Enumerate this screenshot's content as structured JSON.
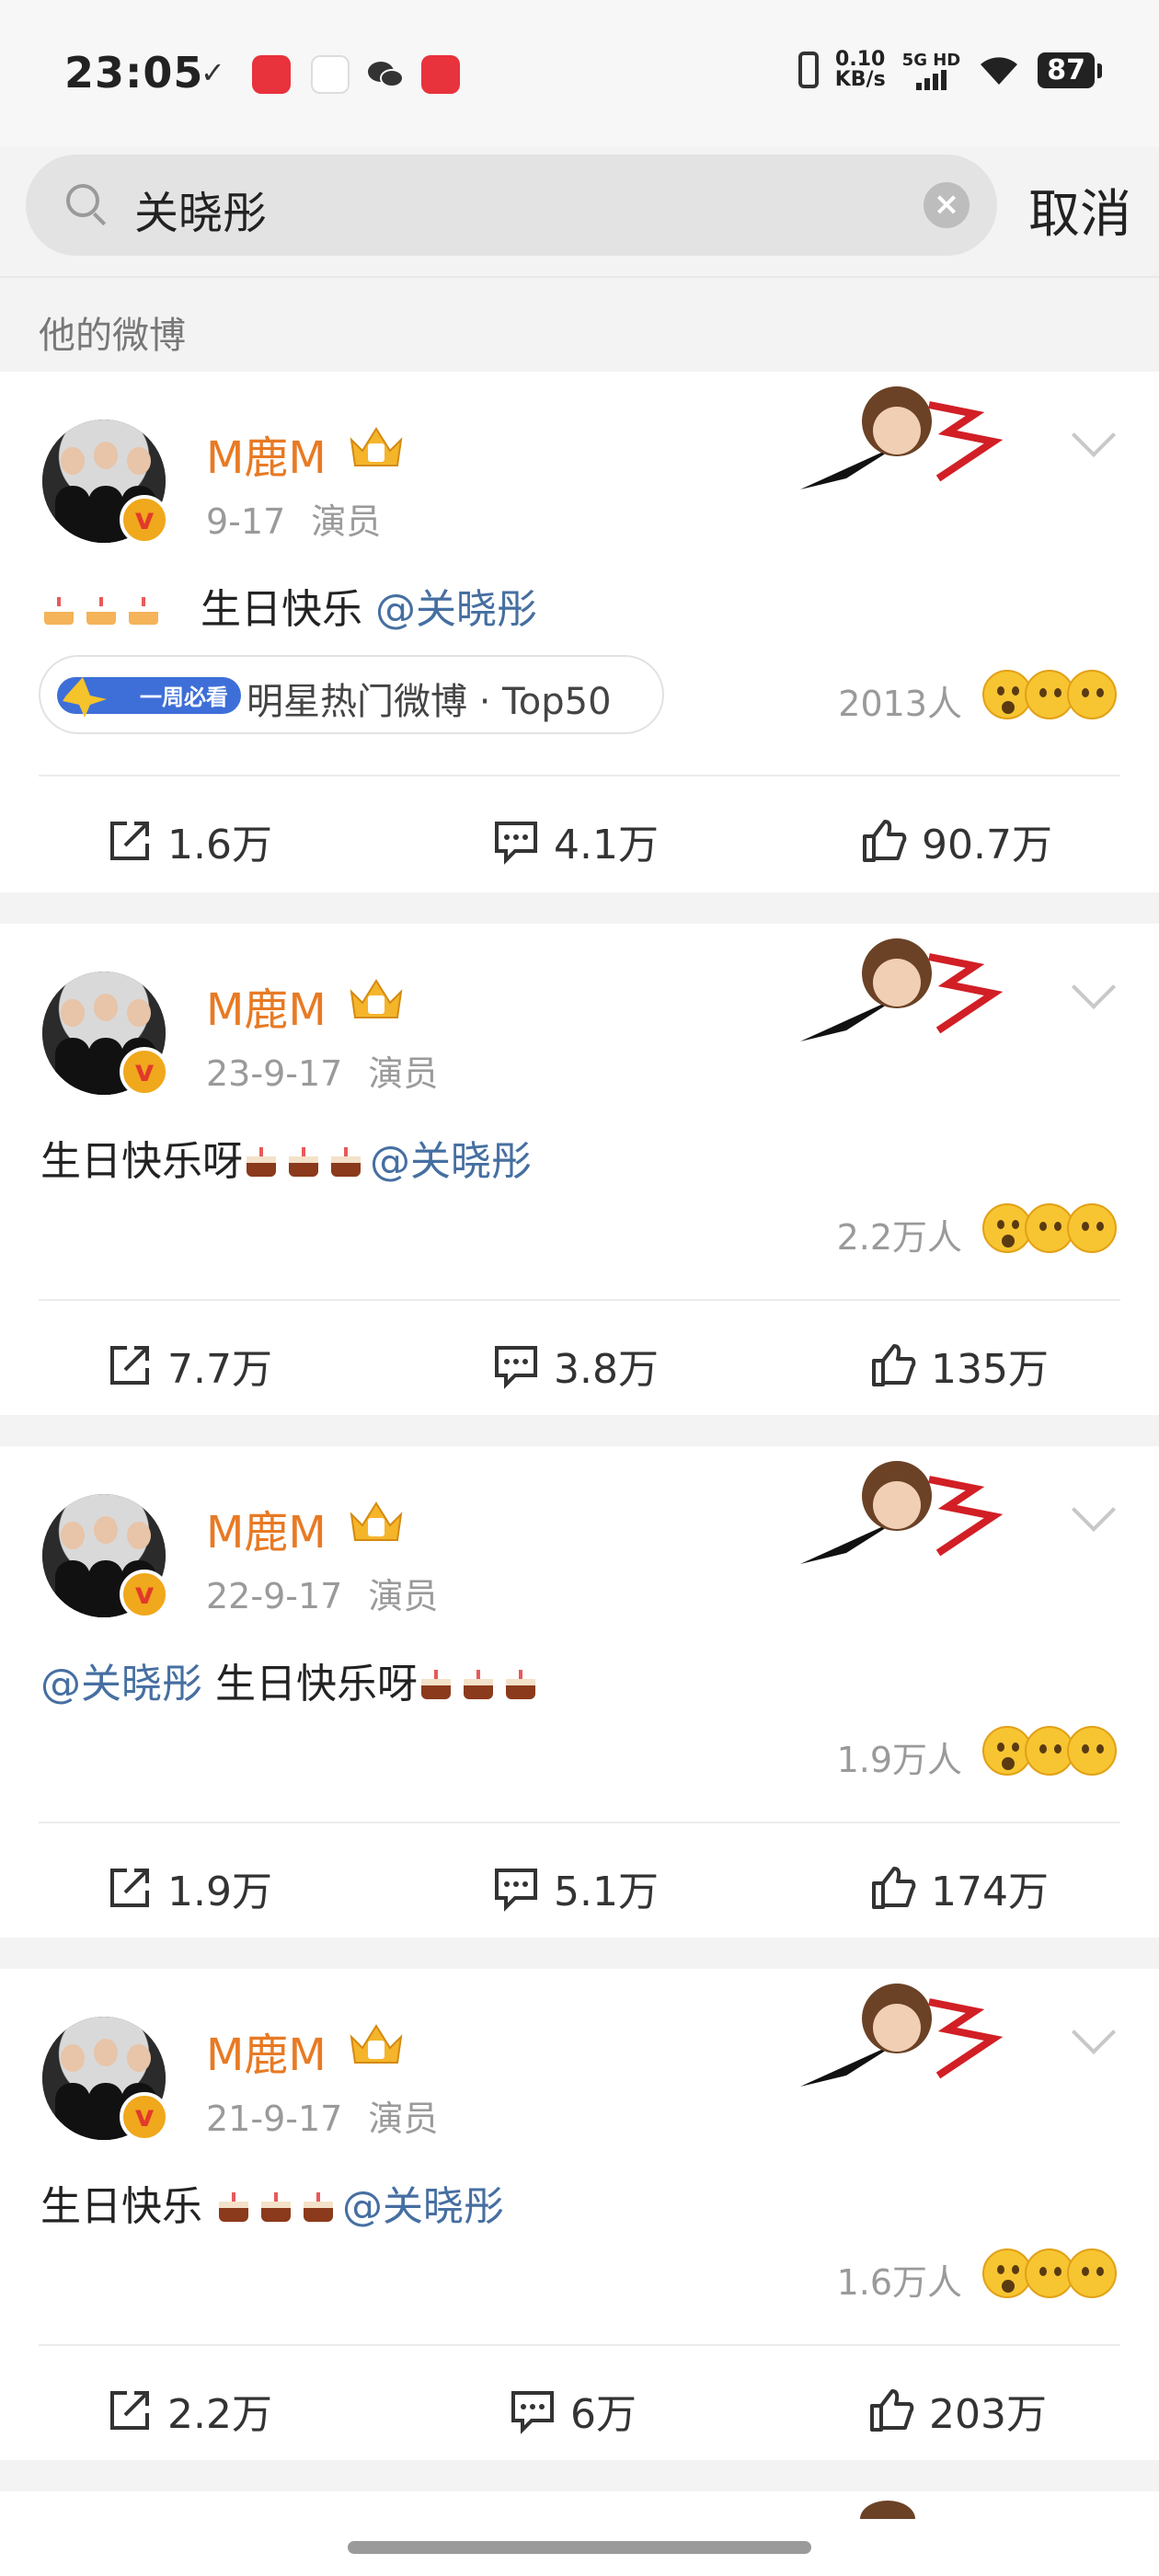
{
  "status_bar": {
    "time": "23:05",
    "net_speed_value": "0.10",
    "net_speed_unit": "KB/s",
    "signal_label": "5G HD",
    "battery": "87",
    "app_icons": [
      "check-icon",
      "xiaohongshu-app-icon",
      "map-app-icon",
      "wechat-app-icon",
      "camera-app-icon"
    ]
  },
  "search": {
    "query": "关晓彤",
    "cancel_label": "取消"
  },
  "section_label": "他的微博",
  "posts": [
    {
      "author": "M鹿M",
      "date": "9-17",
      "role": "演员",
      "text_before": "生日快乐",
      "text_after": "",
      "mention": "@关晓彤",
      "hot_label": "明星热门微博 · Top50",
      "hot_badge": "一周必看",
      "reaction_count": "2013人",
      "shares": "1.6万",
      "comments": "4.1万",
      "likes": "90.7万"
    },
    {
      "author": "M鹿M",
      "date": "23-9-17",
      "role": "演员",
      "text_before": "生日快乐呀",
      "text_after": "",
      "mention": "@关晓彤",
      "reaction_count": "2.2万人",
      "shares": "7.7万",
      "comments": "3.8万",
      "likes": "135万"
    },
    {
      "author": "M鹿M",
      "date": "22-9-17",
      "role": "演员",
      "text_before": "",
      "text_after": "生日快乐呀",
      "mention": "@关晓彤",
      "reaction_count": "1.9万人",
      "shares": "1.9万",
      "comments": "5.1万",
      "likes": "174万"
    },
    {
      "author": "M鹿M",
      "date": "21-9-17",
      "role": "演员",
      "text_before": "生日快乐",
      "text_after": "",
      "mention": "@关晓彤",
      "reaction_count": "1.6万人",
      "shares": "2.2万",
      "comments": "6万",
      "likes": "203万"
    }
  ],
  "colors": {
    "author": "#e87a24",
    "mention": "#466fa1",
    "muted": "#9a9a9a",
    "background": "#f3f3f3"
  }
}
